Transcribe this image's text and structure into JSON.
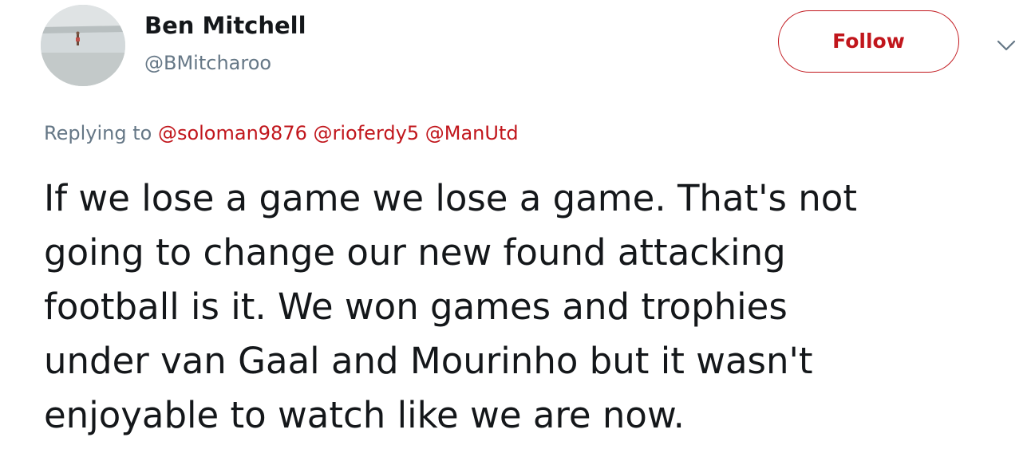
{
  "author": {
    "display_name": "Ben Mitchell",
    "handle": "@BMitcharoo",
    "avatar_icon": "beach-photo-avatar"
  },
  "actions": {
    "follow_label": "Follow",
    "more_icon": "chevron-down-icon"
  },
  "reply": {
    "prefix": "Replying to",
    "mentions": [
      "@soloman9876",
      "@rioferdy5",
      "@ManUtd"
    ]
  },
  "tweet": {
    "text": "If we lose a game we lose a game. That's not\ngoing to change our new found attacking\nfootball is it. We won games and trophies\nunder van Gaal and Mourinho but it wasn't\nenjoyable to watch like we are now."
  },
  "colors": {
    "accent": "#c1161c",
    "muted": "#657786",
    "text": "#14171a"
  }
}
